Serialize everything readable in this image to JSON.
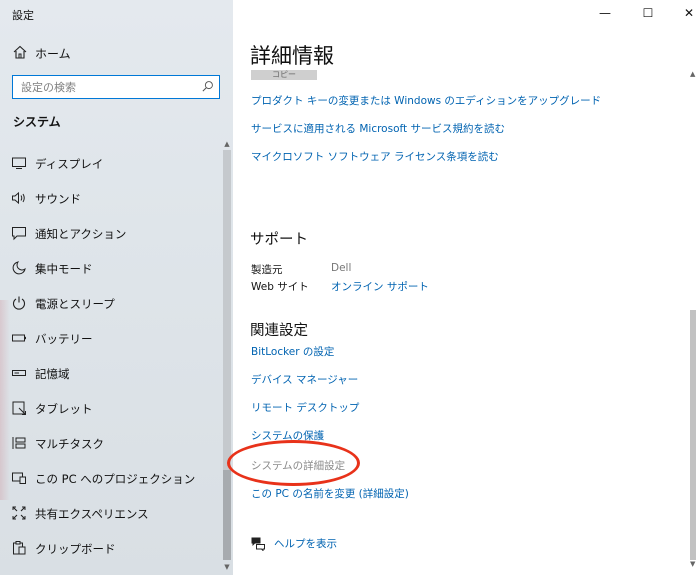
{
  "window": {
    "title": "設定",
    "controls": {
      "minimize": "—",
      "maximize": "☐",
      "close": "✕"
    }
  },
  "sidebar": {
    "home_label": "ホーム",
    "search_placeholder": "設定の検索",
    "section_heading": "システム",
    "items": [
      {
        "label": "ディスプレイ",
        "icon": "display-icon"
      },
      {
        "label": "サウンド",
        "icon": "speaker-icon"
      },
      {
        "label": "通知とアクション",
        "icon": "notification-icon"
      },
      {
        "label": "集中モード",
        "icon": "moon-icon"
      },
      {
        "label": "電源とスリープ",
        "icon": "power-icon"
      },
      {
        "label": "バッテリー",
        "icon": "battery-icon"
      },
      {
        "label": "記憶域",
        "icon": "storage-icon"
      },
      {
        "label": "タブレット",
        "icon": "tablet-icon"
      },
      {
        "label": "マルチタスク",
        "icon": "multitask-icon"
      },
      {
        "label": "この PC へのプロジェクション",
        "icon": "projection-icon"
      },
      {
        "label": "共有エクスペリエンス",
        "icon": "shared-experience-icon"
      },
      {
        "label": "クリップボード",
        "icon": "clipboard-icon"
      }
    ]
  },
  "main": {
    "title": "詳細情報",
    "partial_button": "コピー",
    "top_links": [
      "プロダクト キーの変更または Windows のエディションをアップグレード",
      "サービスに適用される Microsoft サービス規約を読む",
      "マイクロソフト ソフトウェア ライセンス条項を読む"
    ],
    "support": {
      "heading": "サポート",
      "manufacturer_label": "製造元",
      "manufacturer_value": "Dell",
      "website_label": "Web サイト",
      "website_value": "オンライン サポート"
    },
    "related": {
      "heading": "関連設定",
      "links": [
        "BitLocker の設定",
        "デバイス マネージャー",
        "リモート デスクトップ",
        "システムの保護",
        "システムの詳細設定",
        "この PC の名前を変更 (詳細設定)"
      ]
    },
    "help_label": "ヘルプを表示"
  },
  "colors": {
    "accent": "#0078d7",
    "link": "#0063b1",
    "highlight": "#e8321a"
  }
}
